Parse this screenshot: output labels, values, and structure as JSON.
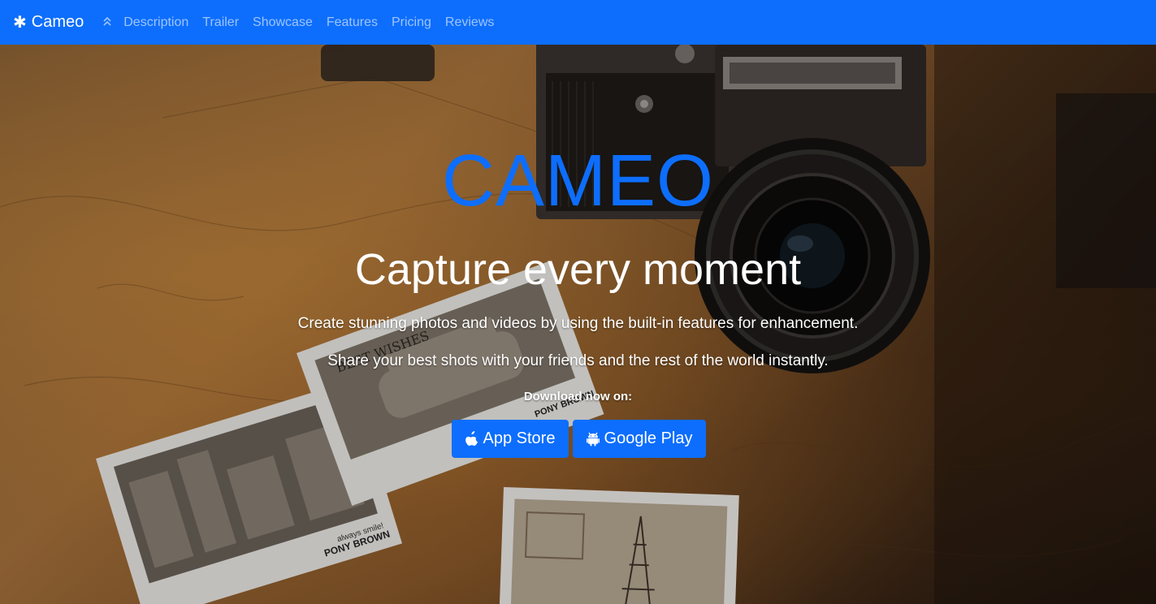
{
  "navbar": {
    "brand": "Cameo",
    "brand_icon": "asterisk-icon",
    "toggle_icon": "chevron-double-up-icon",
    "links": [
      "Description",
      "Trailer",
      "Showcase",
      "Features",
      "Pricing",
      "Reviews"
    ]
  },
  "hero": {
    "title": "CAMEO",
    "subtitle": "Capture every moment",
    "text_1": "Create stunning photos and videos by using the built-in features for enhancement.",
    "text_2": "Share your best shots with your friends and the rest of the world instantly.",
    "download_label": "Download now on:",
    "buttons": {
      "app_store": "App Store",
      "google_play": "Google Play"
    },
    "photo_captions": {
      "card_1_line_1": "always smile!",
      "card_1_line_2": "PONY BROWN",
      "card_2_stamp": "BEST WISHES"
    }
  },
  "colors": {
    "accent": "#0d6efd",
    "nav_link": "#9fc4ff",
    "text": "#ffffff"
  }
}
